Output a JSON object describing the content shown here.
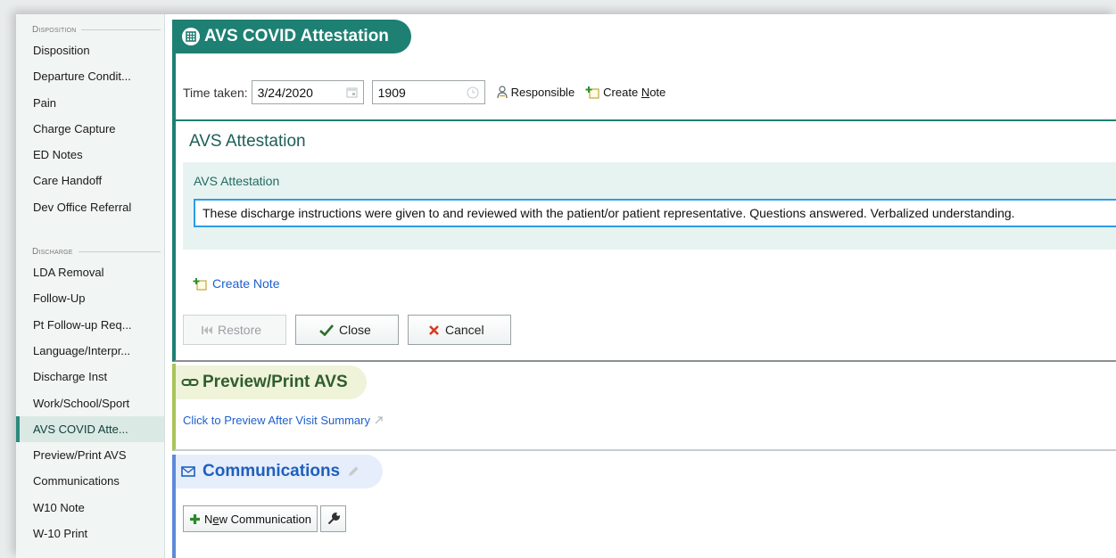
{
  "sidebar": {
    "sections": [
      {
        "title": "Disposition",
        "items": [
          "Disposition",
          "Departure Condit...",
          "Pain",
          "Charge Capture",
          "ED Notes",
          "Care Handoff",
          "Dev Office Referral"
        ]
      },
      {
        "title": "Discharge",
        "items": [
          "LDA Removal",
          "Follow-Up",
          "Pt Follow-up Req...",
          "Language/Interpr...",
          "Discharge Inst",
          "Work/School/Sport",
          "AVS COVID Atte...",
          "Preview/Print AVS",
          "Communications",
          "W10 Note",
          "W-10 Print"
        ]
      }
    ],
    "active_item": "AVS COVID Atte..."
  },
  "attestation": {
    "header": "AVS COVID Attestation",
    "time_taken_label": "Time taken:",
    "date_value": "3/24/2020",
    "time_value": "1909",
    "responsible_label": "Responsible",
    "create_note_prefix": "Create ",
    "create_note_underlined": "N",
    "create_note_suffix": "ote",
    "subtitle": "AVS Attestation",
    "panel_label": "AVS Attestation",
    "attestation_text": "These discharge instructions were given to and reviewed with the patient/or patient representative. Questions answered. Verbalized understanding.",
    "create_note_link": "Create Note",
    "buttons": {
      "restore": "Restore",
      "close": "Close",
      "cancel": "Cancel"
    }
  },
  "preview": {
    "header": "Preview/Print AVS",
    "link": "Click to Preview After Visit Summary"
  },
  "communications": {
    "header": "Communications",
    "new_button_prefix": "N",
    "new_button_underlined": "e",
    "new_button_suffix": "w Communication"
  },
  "colors": {
    "teal": "#1e7f73",
    "green_accent": "#a9c45b",
    "blue_accent": "#5d8ad7",
    "link_blue": "#1d5fcf",
    "cancel_red": "#d93a1e",
    "check_green": "#2a6f2a"
  }
}
